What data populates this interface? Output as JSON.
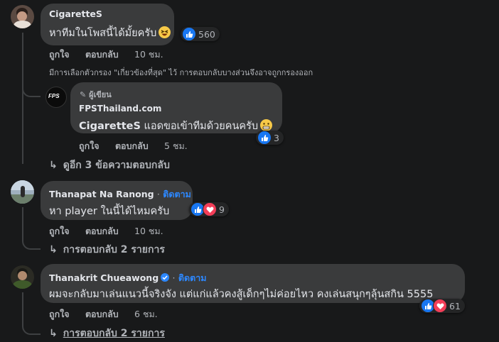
{
  "comments": [
    {
      "author": "CigaretteS",
      "text": "หาทีมในโพสนี้ได้มั้ยครับ",
      "reaction_count": "560",
      "actions": {
        "like": "ถูกใจ",
        "reply": "ตอบกลับ",
        "time": "10 ชม."
      },
      "filter_note": "มีการเลือกตัวกรอง \"เกี่ยวข้องที่สุด\" ไว้ การตอบกลับบางส่วนจึงอาจถูกกรองออก",
      "reply": {
        "badge": "ผู้เขียน",
        "author": "FPSThailand.com",
        "mention": "CigaretteS",
        "text": "แอดขอเข้าทีมด้วยคนครับ",
        "reaction_count": "3",
        "logo_text": "FPS",
        "actions": {
          "like": "ถูกใจ",
          "reply": "ตอบกลับ",
          "time": "5 ชม."
        }
      },
      "more_replies": "ดูอีก 3 ข้อความตอบกลับ"
    },
    {
      "author": "Thanapat Na Ranong",
      "follow": "ติดตาม",
      "text": "หา player ในนี้ได้ไหมครับ",
      "reaction_count": "9",
      "actions": {
        "like": "ถูกใจ",
        "reply": "ตอบกลับ",
        "time": "10 ชม."
      },
      "more_replies": "การตอบกลับ 2 รายการ"
    },
    {
      "author": "Thanakrit Chueawong",
      "follow": "ติดตาม",
      "text": "ผมจะกลับมาเล่นแนวนี้จริงจัง แต่แก่แล้วคงสู้เด็กๆไม่ค่อยไหว คงเล่นสนุกๆลุ้นสกิน 5555",
      "reaction_count": "61",
      "actions": {
        "like": "ถูกใจ",
        "reply": "ตอบกลับ",
        "time": "6 ชม."
      },
      "more_replies": "การตอบกลับ 2 รายการ"
    }
  ],
  "separator": "·",
  "arrow_glyph": "↳",
  "colors": {
    "background": "#18191a",
    "bubble": "#3a3b3c",
    "link": "#2d88ff",
    "like": "#1877f2",
    "love": "#f33e58"
  }
}
